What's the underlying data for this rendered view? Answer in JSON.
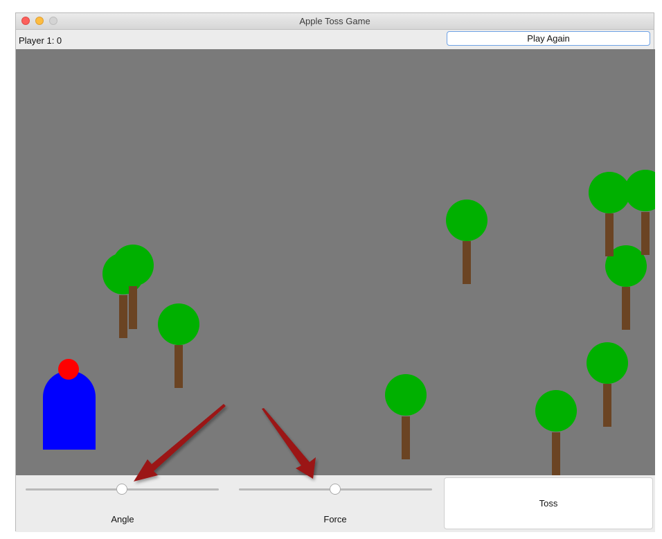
{
  "window": {
    "title": "Apple Toss Game"
  },
  "header": {
    "score": "Player 1: 0",
    "play_again_label": "Play Again"
  },
  "controls": {
    "angle": {
      "label": "Angle",
      "value_fraction": 0.5
    },
    "force": {
      "label": "Force",
      "value_fraction": 0.5
    },
    "toss_label": "Toss"
  },
  "colors": {
    "field": "#7a7a7a",
    "tree_foliage": "#00b000",
    "tree_trunk": "#6b4423",
    "player": "#0000ff",
    "apple": "#ff0000",
    "arrow": "#9b1212"
  }
}
